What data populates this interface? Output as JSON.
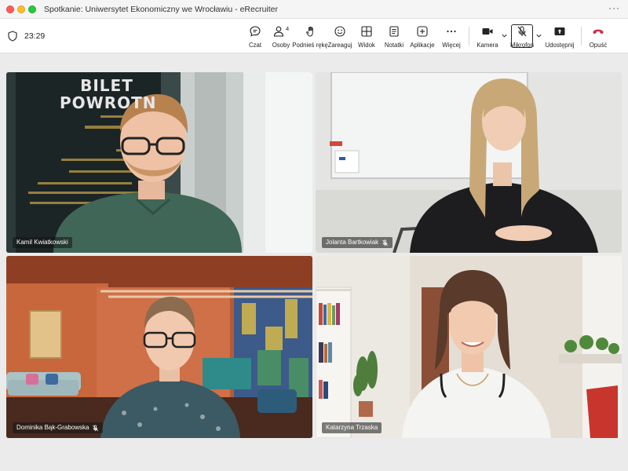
{
  "window": {
    "title": "Spotkanie: Uniwersytet Ekonomiczny we Wrocławiu - eRecruiter",
    "more": "···"
  },
  "toolbar": {
    "timer": "23:29",
    "chat": "Czat",
    "people": "Osoby",
    "people_count": "4",
    "raise_hand": "Podnieś rękę",
    "react": "Zareaguj",
    "view": "Widok",
    "notes": "Notatki",
    "apps": "Aplikacje",
    "more": "Więcej",
    "camera": "Kamera",
    "mic": "Mikrofon",
    "share": "Udostępnij",
    "leave": "Opuść"
  },
  "poster": {
    "title_line1": "BILET",
    "title_line2": "POWROTN"
  },
  "participants": [
    {
      "name": "Kamil Kwiatkowski",
      "muted": false
    },
    {
      "name": "Jolanta Bartkowiak",
      "muted": true
    },
    {
      "name": "Dominika Bąk-Grabowska",
      "muted": true
    },
    {
      "name": "Katarzyna Trzaska",
      "muted": false
    }
  ],
  "colors": {
    "leave": "#c4314b",
    "close": "#ff5f57",
    "minimize": "#febc2e",
    "maximize": "#28c840"
  }
}
